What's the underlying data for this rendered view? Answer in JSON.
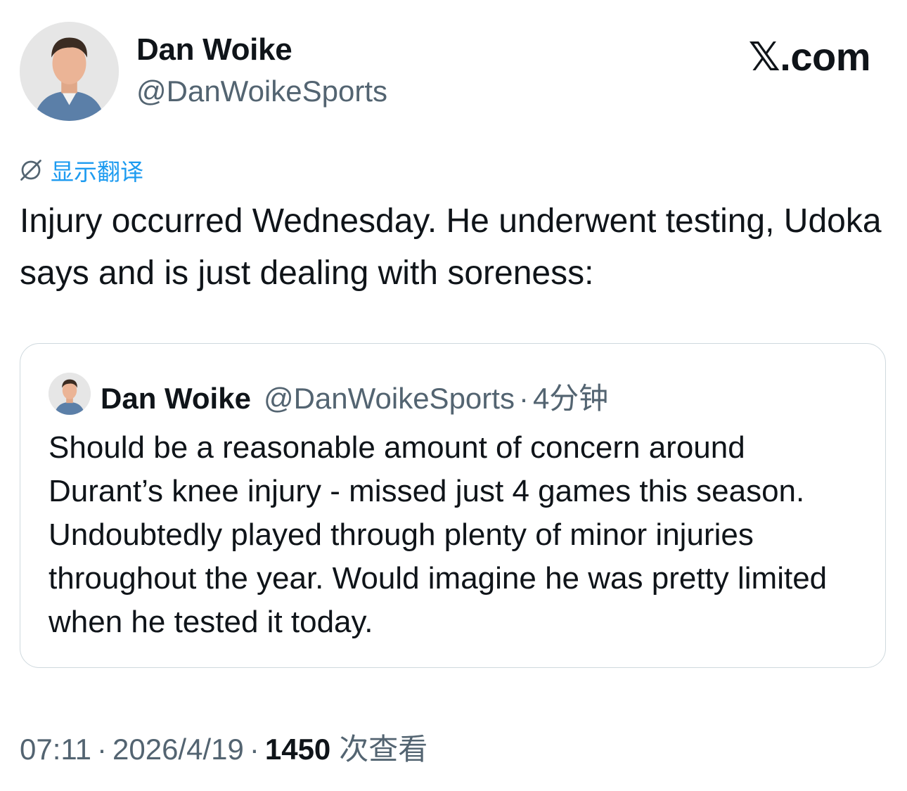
{
  "author": {
    "name": "Dan Woike",
    "handle": "@DanWoikeSports"
  },
  "site": {
    "brand": "𝕏.com"
  },
  "translate": {
    "label": "显示翻译",
    "icon": "globe-translate-icon"
  },
  "tweet": {
    "text": "Injury occurred Wednesday. He underwent testing, Udoka says and is just dealing with soreness:"
  },
  "quote": {
    "name": "Dan Woike",
    "handle": "@DanWoikeSports",
    "separator": "·",
    "time": "4分钟",
    "text": "Should be a reasonable amount of concern around Durant’s knee injury - missed just 4 games this season. Undoubtedly played through plenty of minor injuries throughout the year. Would imagine he was pretty limited when he tested it today."
  },
  "meta": {
    "time": "07:11",
    "separator": "·",
    "date": "2026/4/19",
    "views_count": "1450",
    "views_label": "次查看"
  },
  "colors": {
    "text": "#0f1419",
    "secondary": "#536471",
    "link": "#1d9bf0",
    "border": "#cfd9de"
  }
}
